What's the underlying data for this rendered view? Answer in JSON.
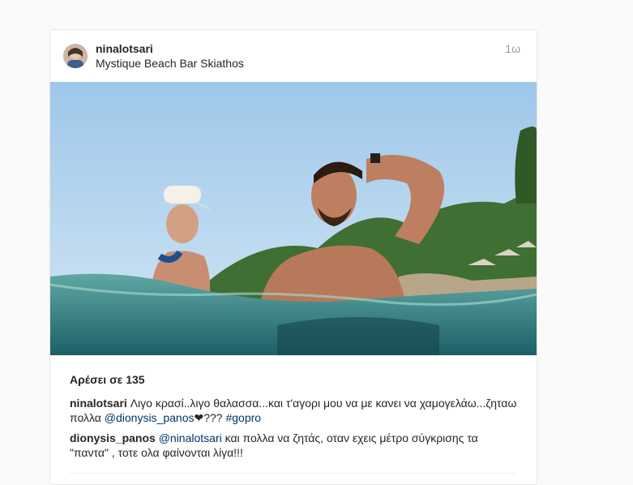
{
  "post": {
    "username": "ninalotsari",
    "location": "Mystique Beach Bar Skiathos",
    "time": "1ω"
  },
  "likes": "Αρέσει σε 135",
  "comments": [
    {
      "user": "ninalotsari",
      "text_1": "Λιγο κρασί..λιγο θαλασσα...και τ'αγορι μου να με κανει να χαμογελάω...ζηταω πολλα",
      "mention": "@dionysis_panos",
      "text_2": "???",
      "hashtag": "#gopro"
    },
    {
      "user": "dionysis_panos",
      "mention": "@ninalotsari",
      "text_1": "και πολλα να ζητάς, οταν εχεις μέτρο σύγκρισης τα \"παντα\" , τοτε ολα φαίνονται λίγα!!!"
    }
  ],
  "colors": {
    "link": "#003569",
    "text": "#262626",
    "muted": "#999999"
  }
}
